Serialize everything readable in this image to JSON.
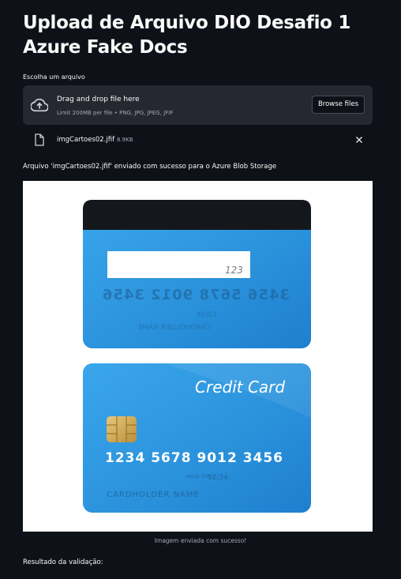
{
  "page": {
    "title": "Upload de Arquivo DIO Desafio 1 Azure Fake Docs"
  },
  "uploader": {
    "label": "Escolha um arquivo",
    "drop_text": "Drag and drop file here",
    "limit_text": "Limit 200MB per file • PNG, JPG, JPEG, JFIF",
    "browse_label": "Browse files",
    "icon": "cloud-upload-icon"
  },
  "uploaded_file": {
    "name": "imgCartoes02.jfif",
    "size": "8.9KB",
    "icon": "file-icon",
    "remove_icon": "close-icon"
  },
  "status": {
    "message": "Arquivo 'imgCartoes02.jfif' enviado com sucesso para o Azure Blob Storage"
  },
  "image": {
    "card_back": {
      "signature_code": "123",
      "mirrored_number": "3456 5678 9012 3456",
      "mirrored_date": "12/34",
      "mirrored_name": "CARDHOLDER NAME"
    },
    "card_front": {
      "brand": "Credit Card",
      "number": "1234 5678 9012 3456",
      "valid_label": "VALID THRU",
      "expiry": "12/34",
      "holder": "CARDHOLDER NAME"
    },
    "caption": "Imagem enviada com sucesso!"
  },
  "result": {
    "label": "Resultado da validação:"
  },
  "colors": {
    "background": "#0e1117",
    "dropzone": "#262730",
    "card_blue": "#2b93dc"
  }
}
